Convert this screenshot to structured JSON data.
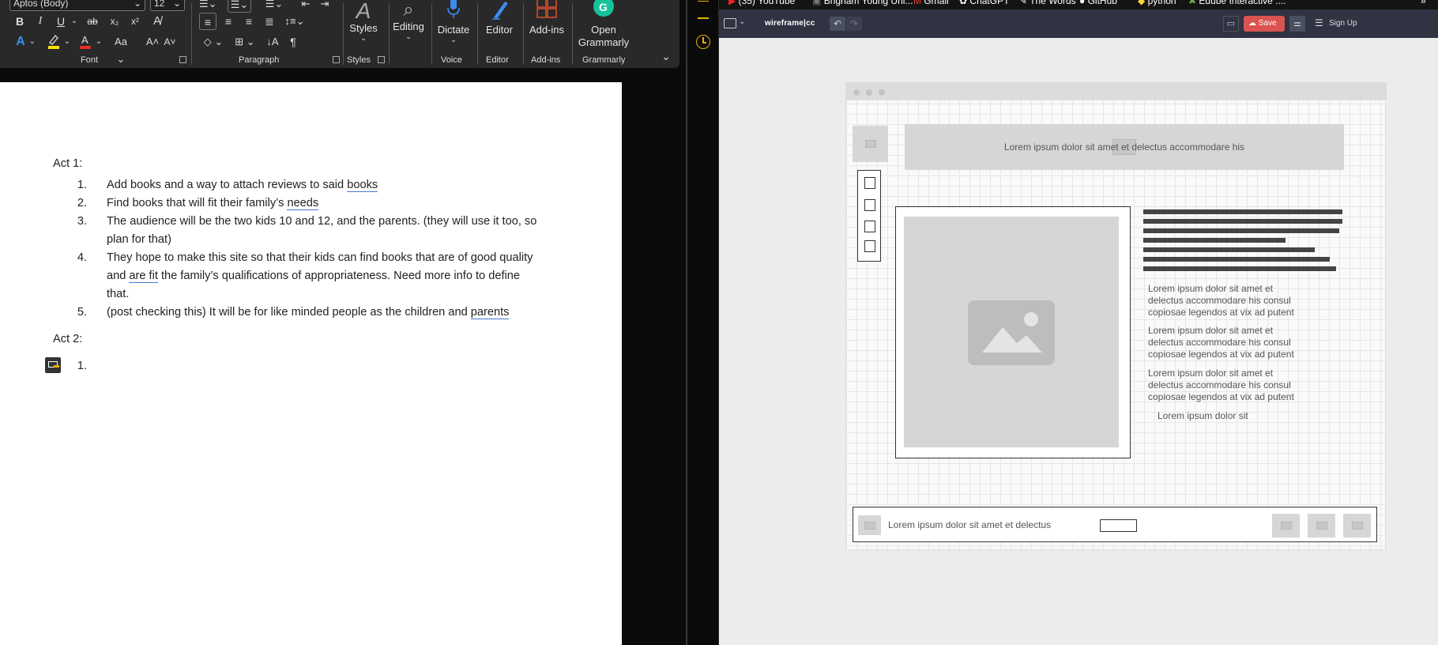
{
  "word": {
    "font_name": "Aptos (Body)",
    "font_size": "12",
    "groups": {
      "font": "Font",
      "paragraph": "Paragraph",
      "styles": "Styles",
      "voice": "Voice",
      "editor": "Editor",
      "addins": "Add-ins",
      "grammarly": "Grammarly"
    },
    "buttons": {
      "styles": "Styles",
      "editing": "Editing",
      "dictate": "Dictate",
      "editor": "Editor",
      "addins": "Add-ins",
      "open_grammarly_1": "Open",
      "open_grammarly_2": "Grammarly"
    },
    "doc": {
      "act1": "Act 1:",
      "act2": "Act 2:",
      "items": [
        {
          "num": "1.",
          "line1": "Add books and a way to attach reviews to said ",
          "sq": "books"
        },
        {
          "num": "2.",
          "line1": "Find books that will fit their family’s ",
          "sq": "needs"
        },
        {
          "num": "3.",
          "line1": "The audience will be the two kids 10 and 12, and the parents. (they will use it too, so",
          "line2": "plan for that)"
        },
        {
          "num": "4.",
          "line1": "They hope to make this site so that their kids can find books that are of good quality",
          "line2a": "and ",
          "line2sq": "are fit",
          "line2b": " the family’s qualifications of appropriateness. Need more info to define",
          "line3": "that."
        },
        {
          "num": "5.",
          "line1": "(post checking this) It will be for like minded people as the children and ",
          "sq": "parents"
        }
      ],
      "act2_num": "1."
    }
  },
  "browser": {
    "bookmarks": [
      "(35) YouTube",
      "Brigham Young Uni...",
      "Gmail",
      "ChatGPT",
      "The Words",
      "GitHub",
      "python",
      "Edube Interactive :..."
    ],
    "brand": "wireframe|cc",
    "save": "Save",
    "sign_up": "Sign Up"
  },
  "wireframe": {
    "header_text": "Lorem ipsum dolor sit amet et delectus accommodare his",
    "paragraphs": [
      [
        "Lorem ipsum dolor sit amet et",
        "delectus accommodare his consul",
        "copiosae legendos at vix ad putent"
      ],
      [
        "Lorem ipsum dolor sit amet et",
        "delectus accommodare his consul",
        "copiosae legendos at vix ad putent"
      ],
      [
        "Lorem ipsum dolor sit amet et",
        "delectus accommodare his consul",
        "copiosae legendos at vix ad putent"
      ]
    ],
    "short_text": "Lorem ipsum dolor sit",
    "footer_text": "Lorem ipsum dolor sit amet et delectus"
  },
  "colors": {
    "ribbon": "#292929",
    "wf_toolbar": "#2f3342",
    "save_button": "#d9534f",
    "squiggle": "#4a78d6",
    "highlighter": "#f5e10a",
    "font_color": "#e0312b"
  }
}
